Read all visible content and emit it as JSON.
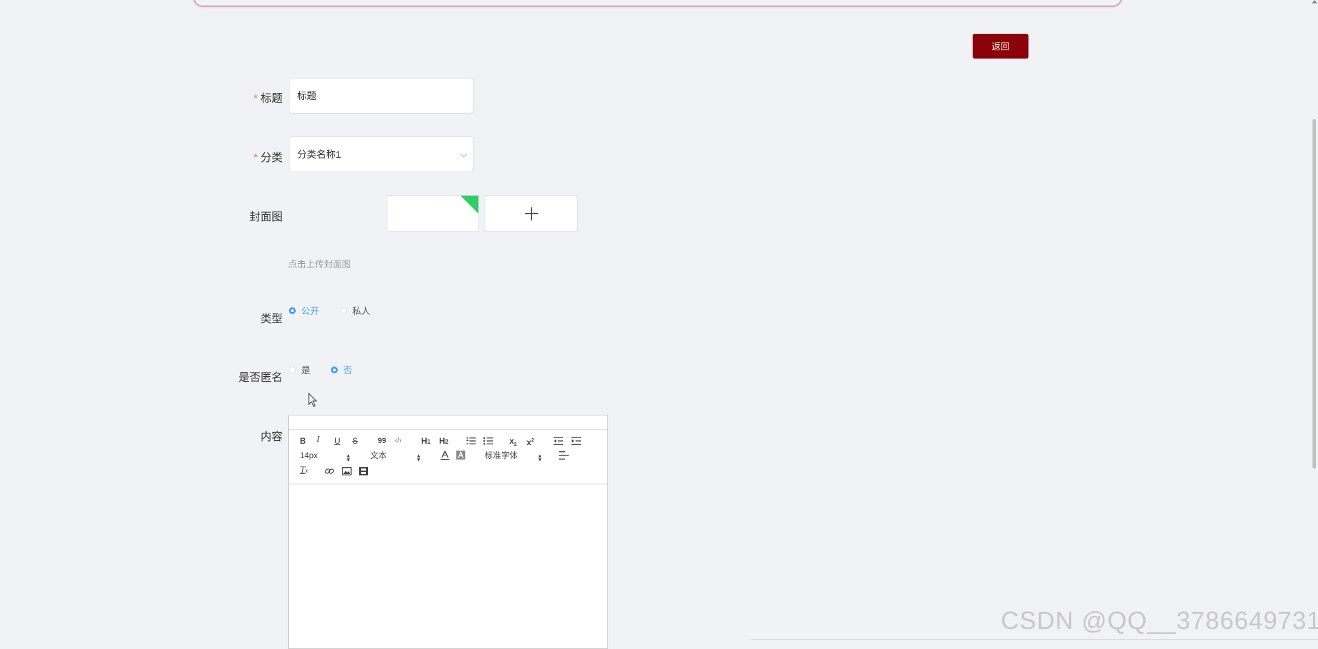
{
  "header": {
    "back_label": "返回"
  },
  "form": {
    "title": {
      "label": "标题",
      "required_mark": "*",
      "value": "标题"
    },
    "category": {
      "label": "分类",
      "required_mark": "*",
      "value": "分类名称1"
    },
    "cover": {
      "label": "封面图",
      "hint": "点击上传封面图",
      "upload_icon": "plus-icon"
    },
    "type": {
      "label": "类型",
      "options": [
        "公开",
        "私人"
      ],
      "selected": "公开"
    },
    "anonymous": {
      "label": "是否匿名",
      "options": [
        "是",
        "否"
      ],
      "selected": "否"
    },
    "content": {
      "label": "内容",
      "toolbar": {
        "font_size": "14px",
        "header_select": "文本",
        "font_family": "标准字体",
        "sub": "x",
        "sub_mark": "2",
        "sup": "x",
        "sup_mark": "2",
        "h1": "H",
        "h1_mark": "1",
        "h2": "H",
        "h2_mark": "2",
        "bold": "B",
        "italic": "I",
        "underline": "U",
        "strike": "S",
        "quote": "99",
        "code": "‹/›",
        "clean": "T",
        "clean_mark": "x"
      }
    }
  },
  "watermark": "CSDN @QQ__3786649731",
  "colors": {
    "primary": "#409eff",
    "back_button": "#8b0208",
    "required": "#f56c6c",
    "cover_corner": "#2fcf63"
  }
}
